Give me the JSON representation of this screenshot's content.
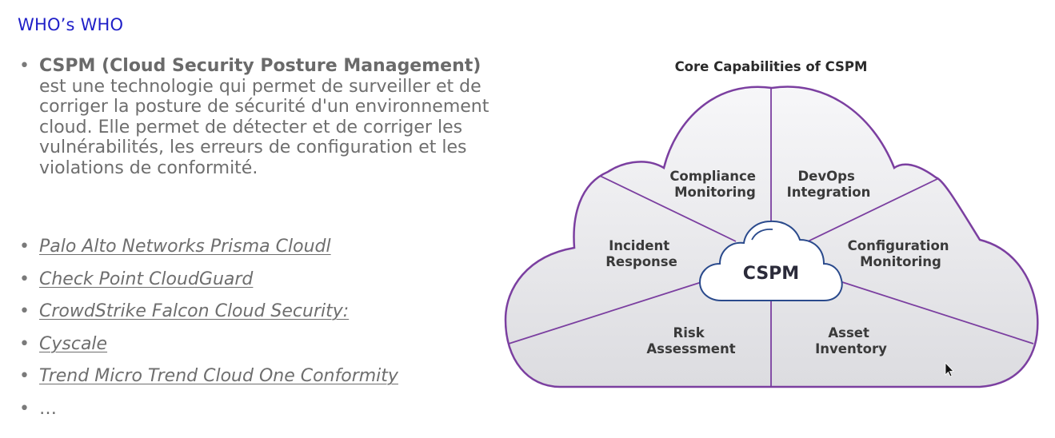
{
  "header": {
    "title": "WHO’s WHO"
  },
  "intro": {
    "term": "CSPM (Cloud Security Posture Management)",
    "text": " est une technologie qui permet de surveiller et de corriger la posture de sécurité d'un environnement cloud. Elle permet de détecter et de corriger les vulnérabilités, les erreurs de configuration et les violations de conformité."
  },
  "vendors": [
    {
      "label": "Palo Alto Networks Prisma Cloudl"
    },
    {
      "label": "Check Point CloudGuard"
    },
    {
      "label": "CrowdStrike Falcon Cloud Security: "
    },
    {
      "label": "Cyscale"
    },
    {
      "label": "Trend Micro Trend Cloud One Conformity"
    },
    {
      "label": "…"
    }
  ],
  "diagram": {
    "title": "Core Capabilities of CSPM",
    "center": "CSPM",
    "capabilities": [
      {
        "line1": "Compliance",
        "line2": "Monitoring"
      },
      {
        "line1": "DevOps",
        "line2": "Integration"
      },
      {
        "line1": "Incident",
        "line2": "Response"
      },
      {
        "line1": "Configuration",
        "line2": "Monitoring"
      },
      {
        "line1": "Risk",
        "line2": "Assessment"
      },
      {
        "line1": "Asset",
        "line2": "Inventory"
      }
    ]
  },
  "colors": {
    "title_blue": "#1f1fc8",
    "cloud_outline": "#7b3fa0",
    "center_outline": "#2a4a8c",
    "text_gray": "#6e6e6e"
  },
  "icons": {
    "bullet": "bullet-dot-icon",
    "pointer": "mouse-pointer-icon"
  }
}
